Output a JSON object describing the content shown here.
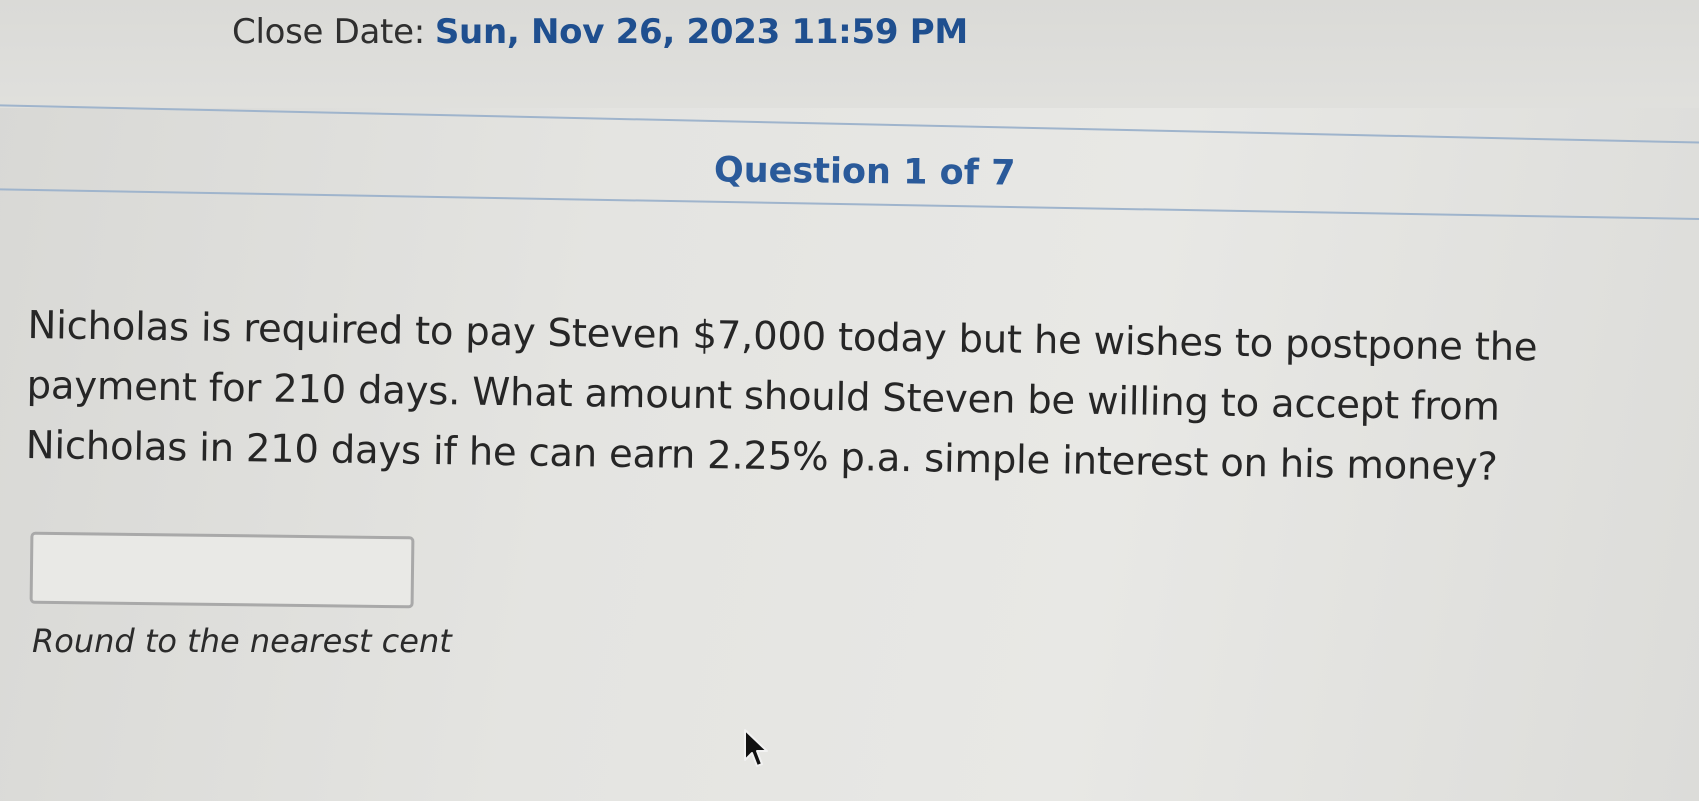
{
  "header": {
    "close_date_label": "Close Date:",
    "close_date_value": "Sun, Nov 26, 2023 11:59 PM"
  },
  "question": {
    "counter": "Question 1 of 7",
    "text": "Nicholas is required to pay Steven $7,000 today but he wishes to postpone the payment for 210 days. What amount should Steven be willing to accept from Nicholas in 210 days if he can earn 2.25% p.a. simple interest on his money?",
    "answer_value": "",
    "hint": "Round to the nearest cent"
  },
  "colors": {
    "accent_text": "#2a5a9a",
    "rule": "#9fb4cc",
    "background": "#e2e2df"
  },
  "icons": {
    "pointer": "arrow-cursor-icon"
  }
}
